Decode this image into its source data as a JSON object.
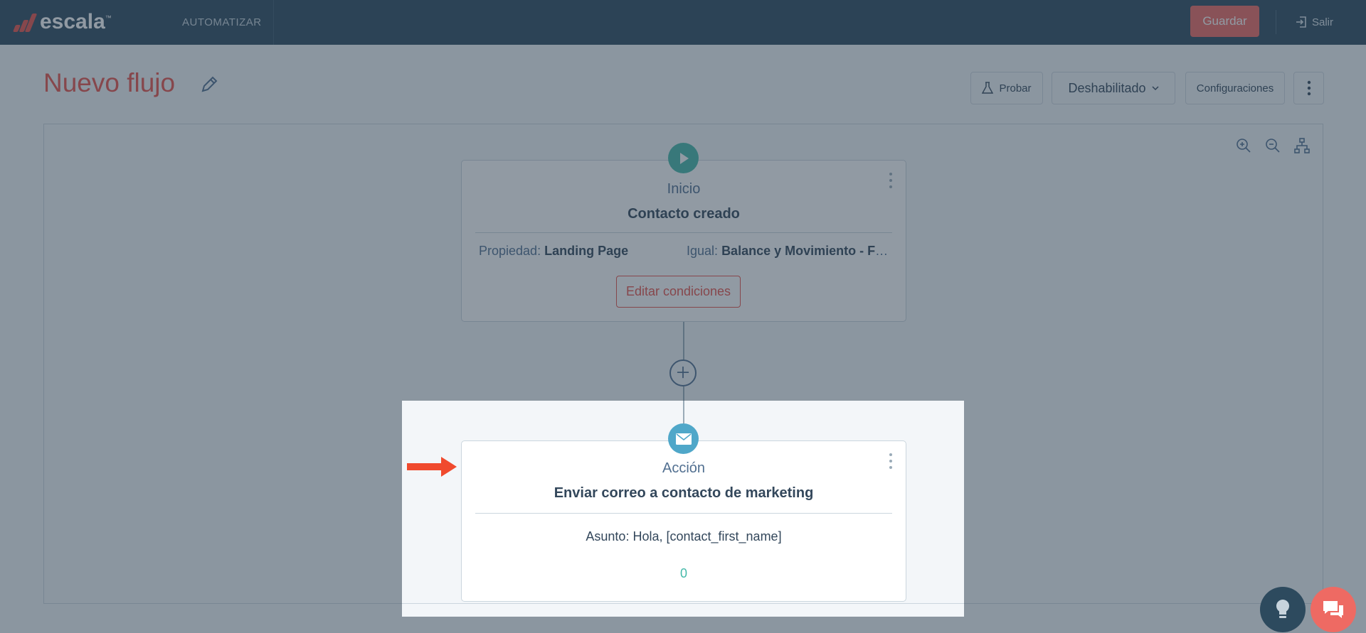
{
  "topbar": {
    "brand": "escala",
    "brand_tm": "™",
    "nav_item": "AUTOMATIZAR",
    "save_label": "Guardar",
    "exit_label": "Salir"
  },
  "header": {
    "title": "Nuevo flujo",
    "test_label": "Probar",
    "status_label": "Deshabilitado",
    "config_label": "Configuraciones"
  },
  "start_node": {
    "kind": "Inicio",
    "name": "Contacto creado",
    "property_label": "Propiedad:",
    "property_value": "Landing Page",
    "operator_label": "Igual:",
    "operator_value": "Balance y Movimiento - Formulario",
    "edit_label": "Editar condiciones"
  },
  "action_node": {
    "kind": "Acción",
    "name": "Enviar correo a contacto de marketing",
    "subject_label": "Asunto:",
    "subject_value": "Hola, [contact_first_name]",
    "count": "0"
  },
  "colors": {
    "nav_bg": "#2d4a5e",
    "accent": "#e8524a",
    "save_bg": "#ee6a63",
    "start_circle": "#45b9a9",
    "action_circle": "#4fa7c9",
    "spotlight_arrow": "#f04a2e"
  },
  "icons": {
    "edit": "pencil-icon",
    "test": "flask-icon",
    "status_caret": "chevron-down-icon",
    "more": "vertical-ellipsis-icon",
    "zoom_in": "zoom-in-icon",
    "zoom_out": "zoom-out-icon",
    "layout": "org-chart-icon",
    "start": "play-icon",
    "action": "envelope-icon",
    "add": "plus-icon",
    "exit": "sign-out-icon",
    "tips": "lightbulb-icon",
    "chat": "chat-icon"
  }
}
